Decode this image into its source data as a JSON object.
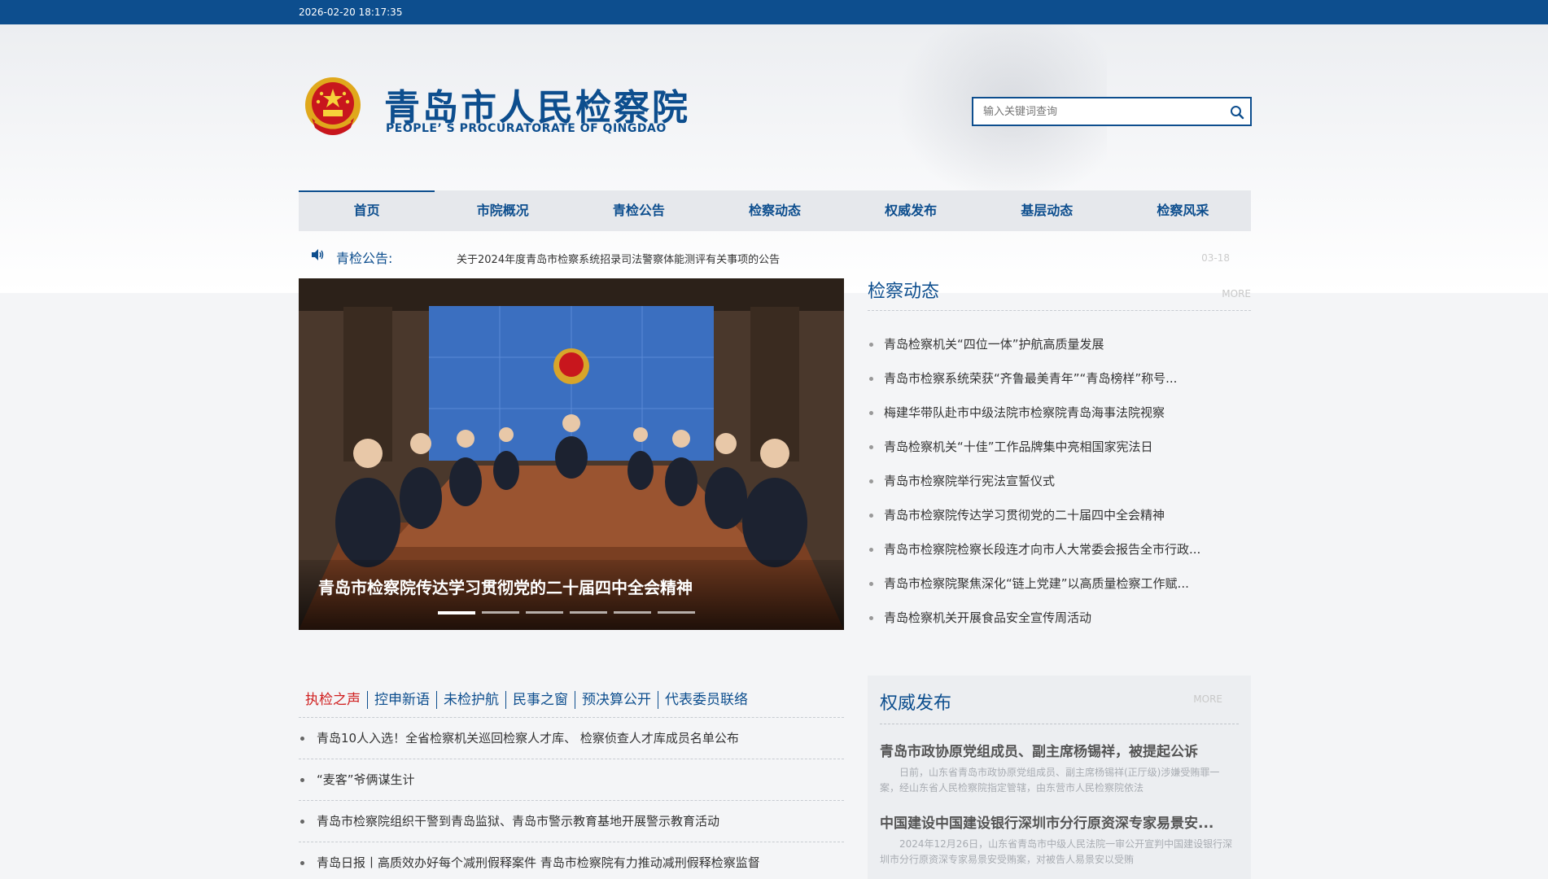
{
  "topbar": {
    "datetime": "2026-02-20 18:17:35"
  },
  "header": {
    "title": "青岛市人民检察院",
    "subtitle": "PEOPLE’ S PROCURATORATE OF QINGDAO",
    "emblem_icon": "national-emblem-icon"
  },
  "search": {
    "placeholder": "输入关键词查询",
    "icon": "search-icon"
  },
  "nav": {
    "items": [
      {
        "label": "首页"
      },
      {
        "label": "市院概况"
      },
      {
        "label": "青检公告"
      },
      {
        "label": "检察动态"
      },
      {
        "label": "权威发布"
      },
      {
        "label": "基层动态"
      },
      {
        "label": "检察风采"
      }
    ]
  },
  "notice": {
    "icon": "speaker-icon",
    "label": "青检公告:",
    "text": "关于2024年度青岛市检察系统招录司法警察体能测评有关事项的公告",
    "date": "03-18"
  },
  "slider": {
    "caption": "青岛市检察院传达学习贯彻党的二十届四中全会精神",
    "active_index": 1,
    "slide_count": 6
  },
  "news": {
    "title": "检察动态",
    "more": "MORE",
    "items": [
      "青岛检察机关“四位一体”护航高质量发展",
      "青岛市检察系统荣获“齐鲁最美青年”“青岛榜样”称号...",
      "梅建华带队赴市中级法院市检察院青岛海事法院视察",
      "青岛检察机关“十佳”工作品牌集中亮相国家宪法日",
      "青岛市检察院举行宪法宣誓仪式",
      "青岛市检察院传达学习贯彻党的二十届四中全会精神",
      "青岛市检察院检察长段连才向市人大常委会报告全市行政...",
      "青岛市检察院聚焦深化“链上党建”以高质量检察工作赋...",
      "青岛检察机关开展食品安全宣传周活动"
    ]
  },
  "tabs": {
    "labels": [
      "执检之声",
      "控申新语",
      "未检护航",
      "民事之窗",
      "预决算公开",
      "代表委员联络"
    ],
    "active_index": 0,
    "items": [
      "青岛10人入选！全省检察机关巡回检察人才库、 检察侦查人才库成员名单公布",
      " “麦客”爷俩谋生计",
      "青岛市检察院组织干警到青岛监狱、青岛市警示教育基地开展警示教育活动",
      "青岛日报丨高质效办好每个减刑假释案件 青岛市检察院有力推动减刑假释检察监督"
    ]
  },
  "authority": {
    "title": "权威发布",
    "more": "MORE",
    "items": [
      {
        "title": "青岛市政协原党组成员、副主席杨锡祥，被提起公诉",
        "summary": "日前，山东省青岛市政协原党组成员、副主席杨锡祥(正厅级)涉嫌受贿罪一案，经山东省人民检察院指定管辖，由东营市人民检察院依法"
      },
      {
        "title": "中国建设中国建设银行深圳市分行原资深专家易景安...",
        "summary": "2024年12月26日，山东省青岛市中级人民法院一审公开宣判中国建设银行深圳市分行原资深专家易景安受贿案，对被告人易景安以受贿"
      }
    ]
  },
  "colors": {
    "brand_blue": "#0d4e8e",
    "nav_bg": "#e6e8ec",
    "active_tab_red": "#d02020"
  }
}
